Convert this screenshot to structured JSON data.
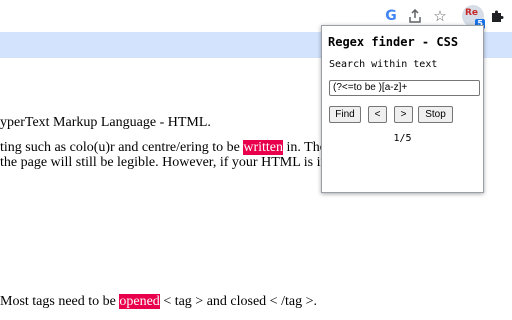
{
  "toolbar": {
    "icons": [
      "google-lens-icon",
      "share-icon",
      "star-icon",
      "regex-finder-extension-icon",
      "extensions-puzzle-icon"
    ],
    "google_label": "G",
    "extension_label": "Re",
    "extension_badge": "5"
  },
  "page": {
    "line1": "yperText Markup Language - HTML.",
    "line2_before": "ting such as colo(u)r and centre/ering to be ",
    "line2_match": "written",
    "line2_after": " in. The pro",
    "line3": " the page will still be legible. However, if your HTML is inaccu",
    "line4_before": " Most tags need to be ",
    "line4_match": "opened",
    "line4_after": " < tag > and closed < /tag >.",
    "highlight_color": "#e8004d"
  },
  "popup": {
    "title": "Regex finder - CSS",
    "subtitle": "Search within text",
    "input_value": "(?<=to be )[a-z]+",
    "find_label": "Find",
    "prev_label": "<",
    "next_label": ">",
    "stop_label": "Stop",
    "count": "1/5"
  }
}
